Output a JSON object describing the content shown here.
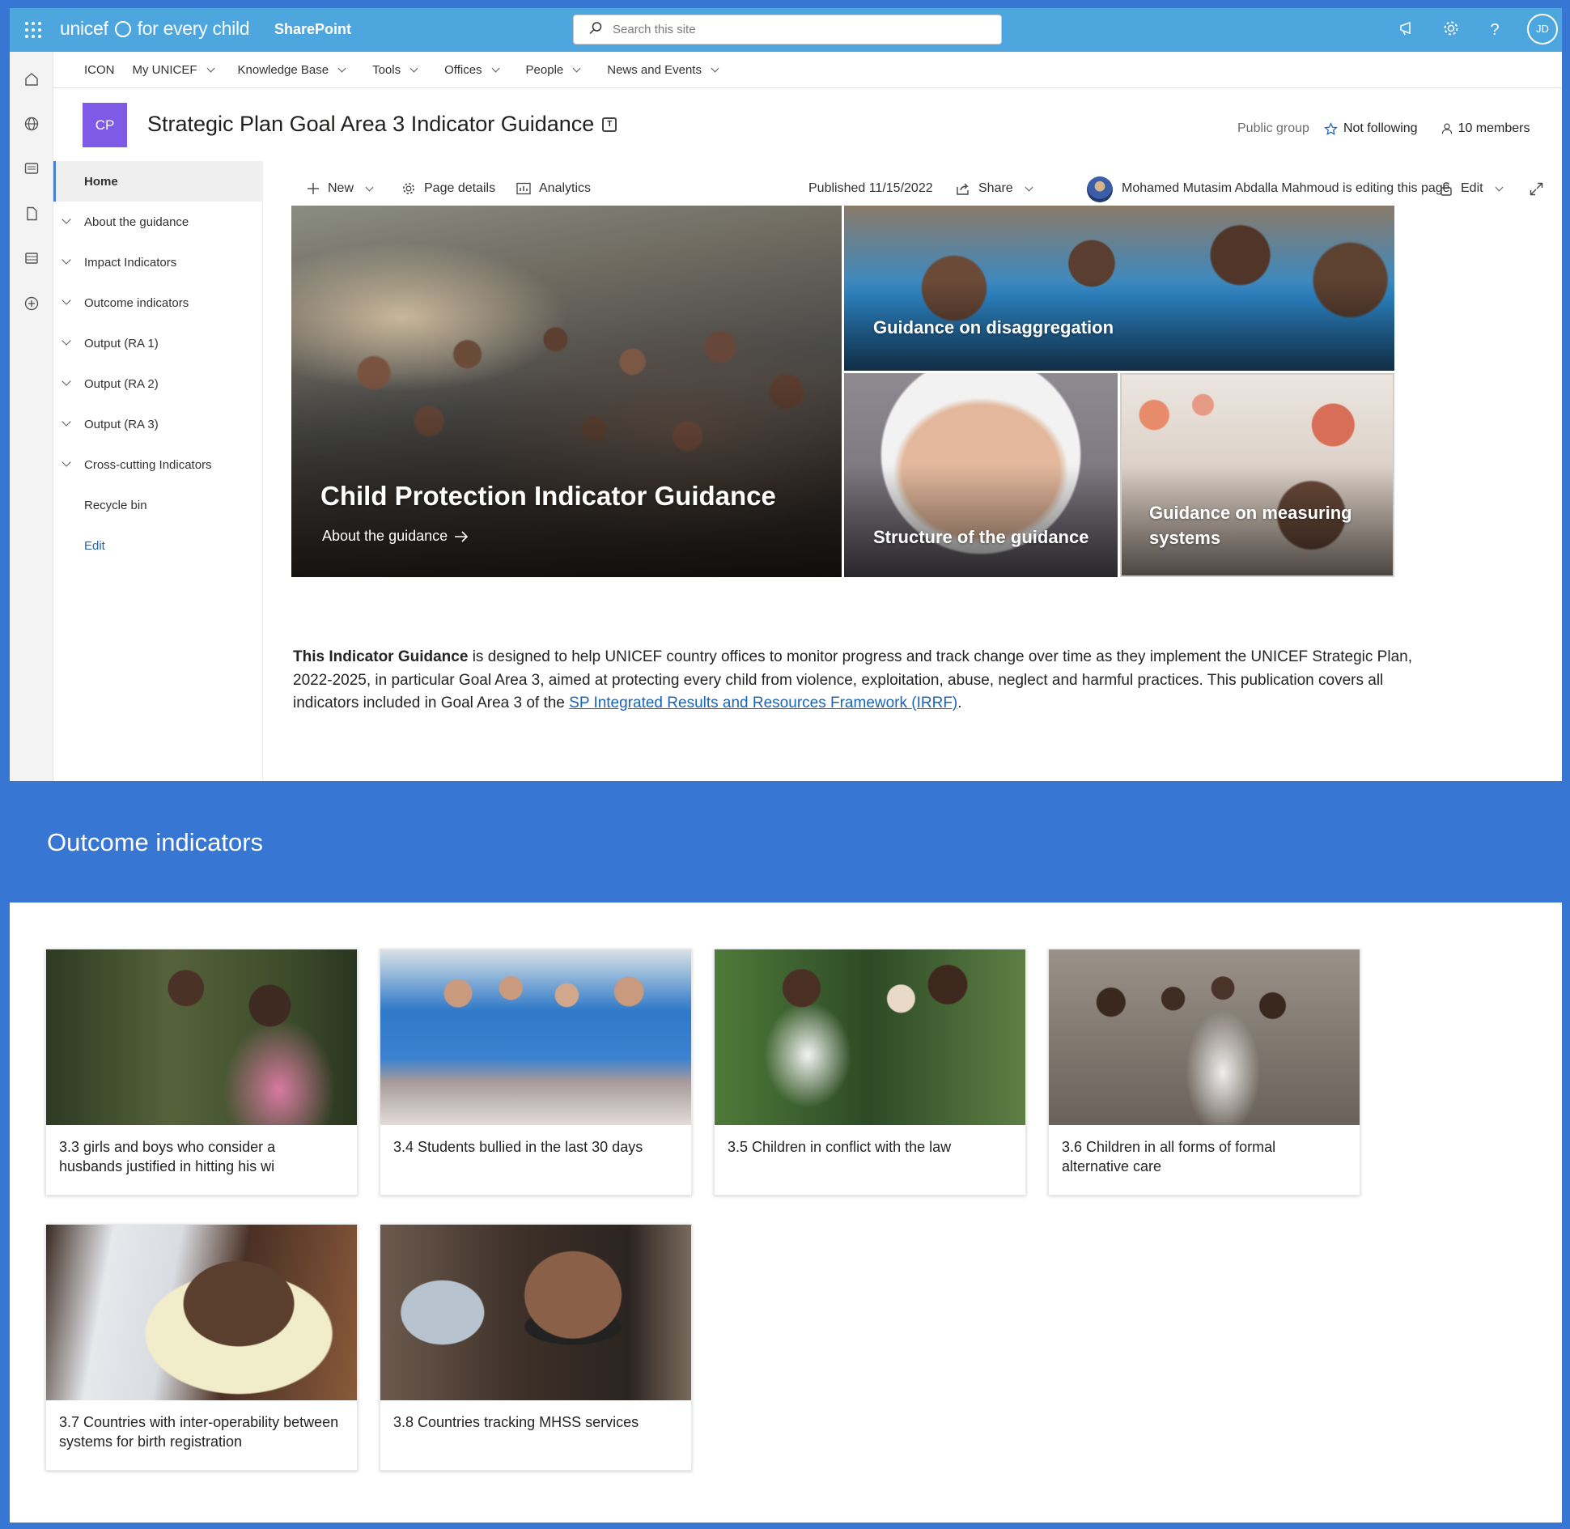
{
  "suite": {
    "logo": "unicef",
    "logo_tagline": "for every child",
    "app_name": "SharePoint",
    "search_placeholder": "Search this site",
    "avatar_initials": "JD",
    "icons": [
      "waffle-icon",
      "megaphone-icon",
      "gear-icon",
      "help-icon"
    ]
  },
  "hub_nav": {
    "items": [
      {
        "label": "ICON",
        "dropdown": false
      },
      {
        "label": "My UNICEF",
        "dropdown": true
      },
      {
        "label": "Knowledge Base",
        "dropdown": true
      },
      {
        "label": "Tools",
        "dropdown": true
      },
      {
        "label": "Offices",
        "dropdown": true
      },
      {
        "label": "People",
        "dropdown": true
      },
      {
        "label": "News and Events",
        "dropdown": true
      }
    ]
  },
  "site": {
    "icon_initials": "CP",
    "title": "Strategic Plan Goal Area 3 Indicator Guidance",
    "privacy": "Public group",
    "follow_label": "Not following",
    "members_label": "10 members"
  },
  "left_nav": {
    "items": [
      {
        "label": "Home",
        "expandable": false,
        "selected": true
      },
      {
        "label": "About the guidance",
        "expandable": true
      },
      {
        "label": "Impact Indicators",
        "expandable": true
      },
      {
        "label": "Outcome indicators",
        "expandable": true
      },
      {
        "label": "Output (RA 1)",
        "expandable": true
      },
      {
        "label": "Output (RA 2)",
        "expandable": true
      },
      {
        "label": "Output (RA 3)",
        "expandable": true
      },
      {
        "label": "Cross-cutting Indicators",
        "expandable": true
      },
      {
        "label": "Recycle bin",
        "expandable": false
      }
    ],
    "edit_label": "Edit"
  },
  "command_bar": {
    "new_label": "New",
    "page_details_label": "Page details",
    "analytics_label": "Analytics",
    "published": "Published 11/15/2022",
    "share_label": "Share",
    "editing_notice": "Mohamed Mutasim Abdalla Mahmoud is editing this page",
    "edit_label": "Edit"
  },
  "hero": {
    "main": {
      "title": "Child Protection Indicator Guidance",
      "link": "About the guidance"
    },
    "tiles": [
      {
        "title": "Guidance on disaggregation"
      },
      {
        "title": "Structure of the guidance"
      },
      {
        "title": "Guidance on measuring systems"
      }
    ]
  },
  "intro": {
    "bold": "This Indicator Guidance",
    "text1": " is designed to help UNICEF country offices to monitor progress and track change over time as they implement the UNICEF Strategic Plan, 2022-2025, in particular Goal Area 3, aimed at protecting every child from violence, exploitation, abuse, neglect and harmful practices. This publication covers all indicators included in Goal Area 3 of the ",
    "link": "SP Integrated Results and Resources Framework (IRRF)",
    "text2": "."
  },
  "outcome": {
    "heading": "Outcome indicators",
    "cards": [
      {
        "caption": "3.3 girls and boys who consider a husbands justified in hitting his wi"
      },
      {
        "caption": "3.4 Students bullied in the last 30 days"
      },
      {
        "caption": "3.5 Children in conflict with the law"
      },
      {
        "caption": "3.6 Children in all forms of formal alternative care"
      },
      {
        "caption": "3.7 Countries with inter-operability between systems for birth registration"
      },
      {
        "caption": "3.8 Countries tracking MHSS services"
      }
    ]
  },
  "colors": {
    "suite_bar": "#4ea6de",
    "brand_blue": "#3777d3",
    "site_icon": "#7f5ae6",
    "link": "#1a63b8"
  }
}
